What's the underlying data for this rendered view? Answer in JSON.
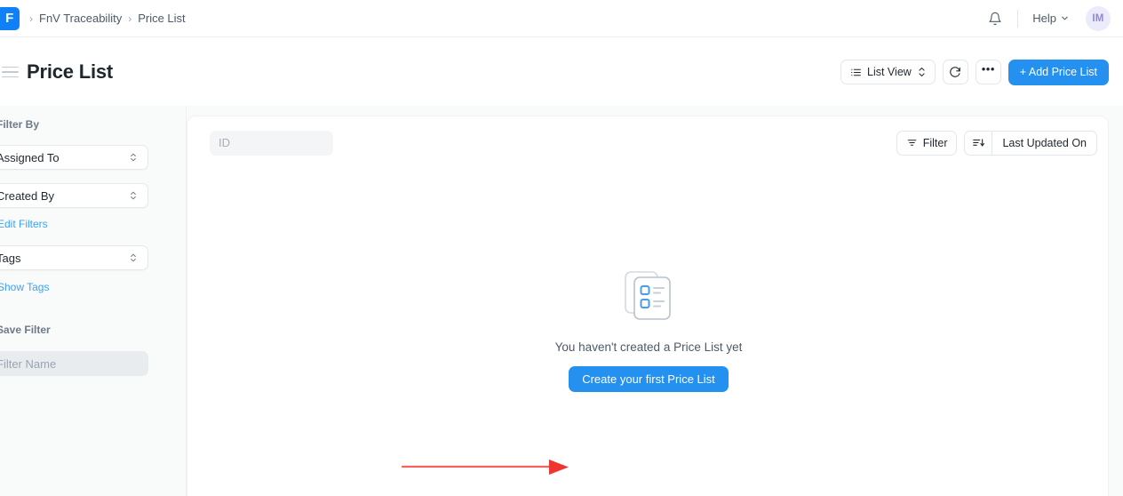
{
  "navbar": {
    "logo_letter": "F",
    "logo_name": "frappe-logo",
    "breadcrumb": [
      {
        "label": "FnV Traceability"
      },
      {
        "label": "Price List"
      }
    ],
    "breadcrumb_separator": "›",
    "bell_icon": "notification-bell-icon",
    "help_label": "Help",
    "avatar_initials": "IM"
  },
  "page_head": {
    "title": "Price List",
    "menu_icon": "hamburger-menu-icon",
    "actions": {
      "list_view_label": "List View",
      "list_view_icon": "list-icon",
      "refresh_icon": "refresh-icon",
      "more_label": "•••",
      "add_label": "+  Add Price List"
    }
  },
  "sidebar": {
    "filter_by_label": "Filter By",
    "filters": [
      {
        "label": "Assigned To",
        "name": "assigned-to"
      },
      {
        "label": "Created By",
        "name": "created-by"
      }
    ],
    "edit_filters_label": "Edit Filters",
    "tags_label": "Tags",
    "show_tags_label": "Show Tags",
    "save_filter_label": "Save Filter",
    "filter_name_placeholder": "Filter Name",
    "filter_name_value": ""
  },
  "list_toolbar": {
    "id_placeholder": "ID",
    "id_value": "",
    "filter_label": "Filter",
    "filter_icon": "funnel-icon",
    "sort_icon": "sort-descending-icon",
    "sort_label": "Last Updated On"
  },
  "empty_state": {
    "illustration_icon": "documents-list-illustration",
    "message": "You haven't created a Price List yet",
    "cta_label": "Create your first Price List"
  },
  "annotation": {
    "arrow_name": "red-pointer-arrow",
    "arrow_color": "#f4645f",
    "points_to": "Create your first Price List"
  },
  "colors": {
    "primary": "#2490ef",
    "logo": "#0f80f5",
    "link": "#3ca2f5",
    "page_bg": "#f9fafa",
    "avatar_bg": "#ecebfb",
    "avatar_fg": "#8e8ccc",
    "annotation_red": "#f4645f"
  }
}
